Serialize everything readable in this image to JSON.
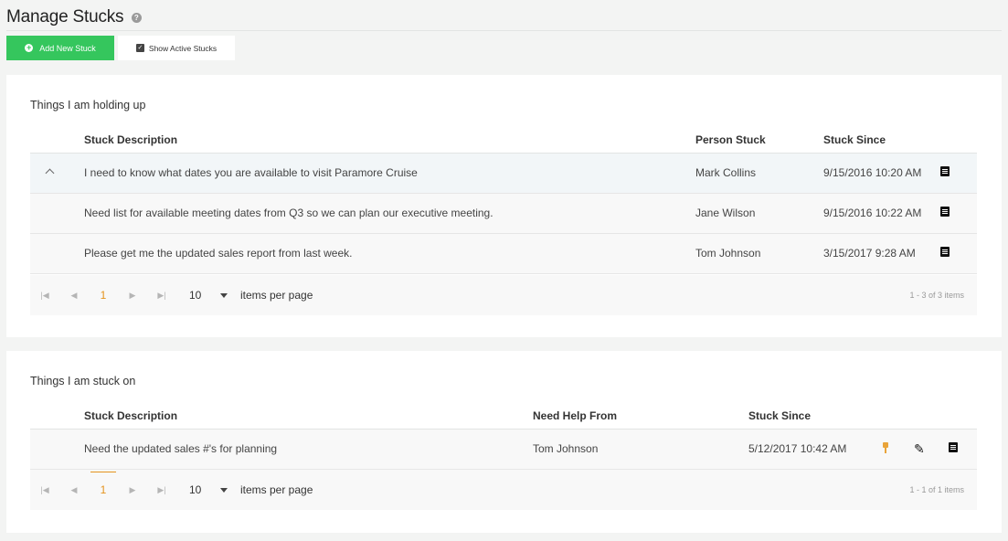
{
  "page": {
    "title": "Manage Stucks",
    "help_icon": "question-circle-icon"
  },
  "toolbar": {
    "add_label": "Add New Stuck",
    "active_label": "Show Active Stucks"
  },
  "holding_up": {
    "title": "Things I am holding up",
    "columns": [
      "Stuck Description",
      "Person Stuck",
      "Stuck Since"
    ],
    "rows": [
      {
        "description": "I need to know what dates you are available to visit Paramore Cruise",
        "person": "Mark Collins",
        "since": "9/15/2016 10:20 AM"
      },
      {
        "description": "Need list for available meeting dates from Q3 so we can plan our executive meeting.",
        "person": "Jane Wilson",
        "since": "9/15/2016 10:22 AM"
      },
      {
        "description": "Please get me the updated sales report from last week.",
        "person": "Tom Johnson",
        "since": "3/15/2017 9:28 AM"
      }
    ],
    "pager": {
      "page": "1",
      "page_size": "10",
      "per_page_label": "items per page",
      "info": "1 - 3 of 3 items"
    }
  },
  "stuck_on": {
    "title": "Things I am stuck on",
    "columns": [
      "Stuck Description",
      "Need Help From",
      "Stuck Since"
    ],
    "rows": [
      {
        "description": "Need the updated sales #'s for planning",
        "person": "Tom Johnson",
        "since": "5/12/2017 10:42 AM"
      }
    ],
    "pager": {
      "page": "1",
      "page_size": "10",
      "per_page_label": "items per page",
      "info": "1 - 1 of 1 items"
    }
  },
  "colors": {
    "accent_green": "#35c65d",
    "pager_active": "#e5941e",
    "pin": "#e9a43a"
  }
}
